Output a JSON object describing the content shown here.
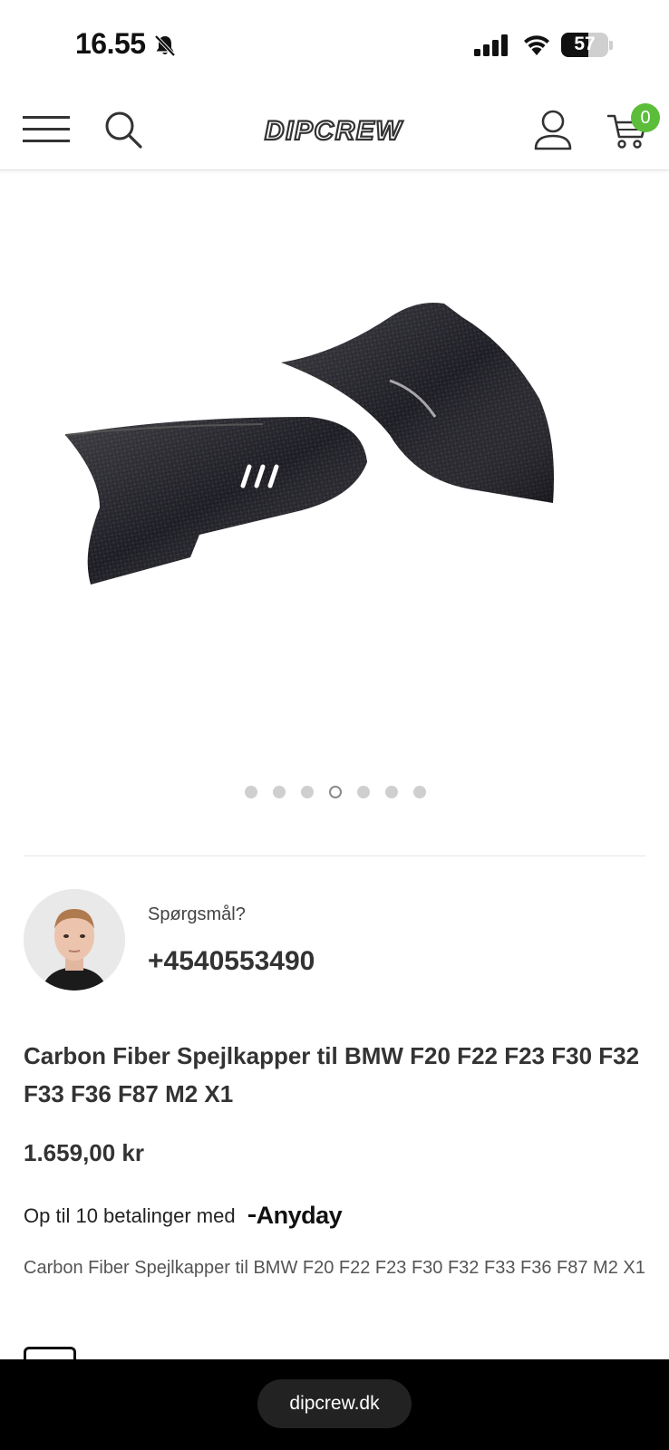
{
  "status_bar": {
    "time": "16.55",
    "battery": "57",
    "battery_level": 0.57
  },
  "header": {
    "logo_text": "DIPCREW",
    "cart_count": "0",
    "badge_color": "#5bbd3a"
  },
  "gallery": {
    "slide_count": 7,
    "active_slide": 4
  },
  "contact": {
    "question": "Spørgsmål?",
    "phone": "+4540553490"
  },
  "product": {
    "title": "Carbon Fiber Spejlkapper til BMW F20 F22 F23 F30 F32 F33 F36 F87 M2 X1",
    "price": "1.659,00 kr",
    "installments_text": "Op til 10 betalinger med",
    "installments_provider": "Anyday",
    "description": "Carbon Fiber Spejlkapper til BMW F20 F22 F23 F30 F32 F33 F36 F87 M2 X1"
  },
  "browser": {
    "url": "dipcrew.dk"
  }
}
